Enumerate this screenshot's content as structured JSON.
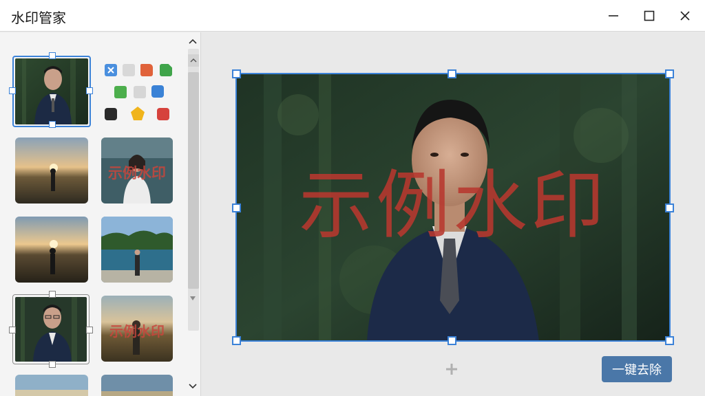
{
  "window": {
    "title": "水印管家",
    "controls": [
      "minimize-icon",
      "maximize-icon",
      "close-icon"
    ]
  },
  "thumbnails": [
    {
      "name": "portrait-forest",
      "selected": true,
      "watermark": ""
    },
    {
      "name": "sunset-figure",
      "selected": false,
      "watermark": ""
    },
    {
      "name": "woman-forest",
      "selected": false,
      "watermark": "示例水印"
    },
    {
      "name": "sunset-figure-2",
      "selected": false,
      "watermark": ""
    },
    {
      "name": "lake-figure",
      "selected": false,
      "watermark": ""
    },
    {
      "name": "portrait-forest-2",
      "selected": true,
      "watermark": ""
    },
    {
      "name": "field-figure",
      "selected": false,
      "watermark": "示例水印"
    }
  ],
  "tool_icons": [
    "close-square-icon",
    "blank-square-icon",
    "folder-icon",
    "document-icon",
    "green-square-icon",
    "gray-square-icon",
    "bag-icon",
    "black-bag-icon",
    "star-icon",
    "gift-icon"
  ],
  "canvas": {
    "watermark_text": "示例水印",
    "remove_button": "一键去除"
  },
  "colors": {
    "accent": "#3b82d8",
    "watermark": "#b8382f",
    "button": "#4a77a8"
  }
}
